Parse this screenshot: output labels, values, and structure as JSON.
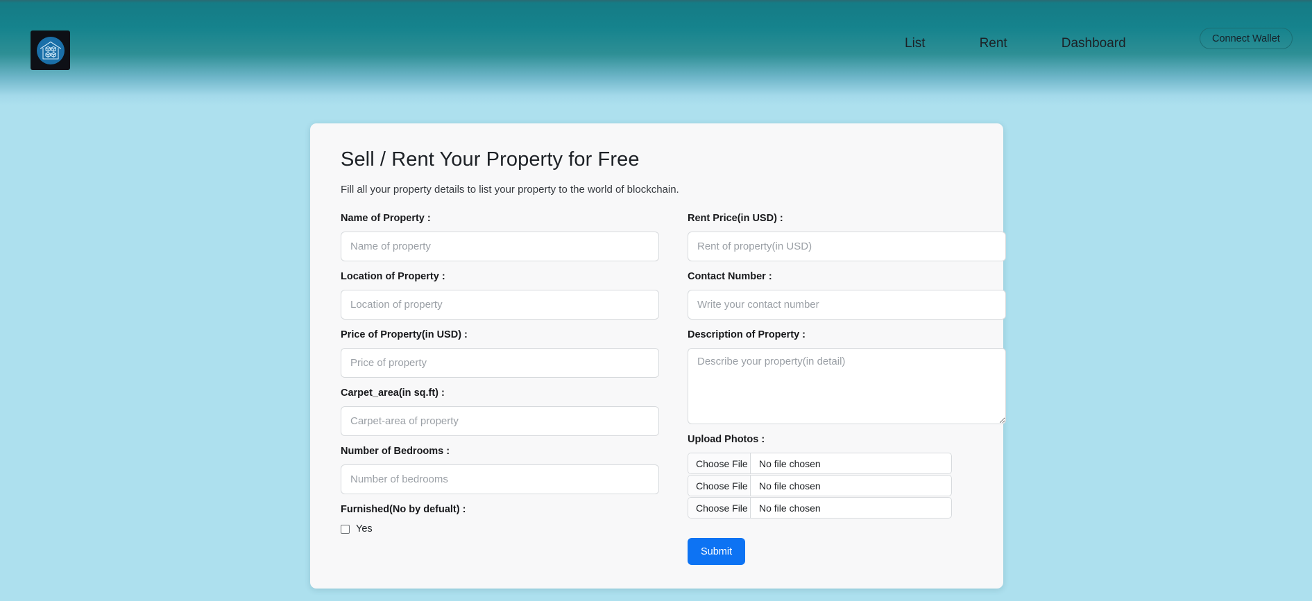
{
  "header": {
    "logo_icon": "blockchain-house-icon",
    "nav": [
      {
        "label": "List"
      },
      {
        "label": "Rent"
      },
      {
        "label": "Dashboard"
      }
    ],
    "wallet_button": "Connect Wallet"
  },
  "card": {
    "title": "Sell / Rent Your Property for Free",
    "subtitle": "Fill all your property details to list your property to the world of blockchain.",
    "left_column": {
      "name": {
        "label": "Name of Property :",
        "placeholder": "Name of property",
        "value": ""
      },
      "location": {
        "label": "Location of Property :",
        "placeholder": "Location of property",
        "value": ""
      },
      "price": {
        "label": "Price of Property(in USD) :",
        "placeholder": "Price of property",
        "value": ""
      },
      "carpet_area": {
        "label": "Carpet_area(in sq.ft) :",
        "placeholder": "Carpet-area of property",
        "value": ""
      },
      "bedrooms": {
        "label": "Number of Bedrooms :",
        "placeholder": "Number of bedrooms",
        "value": ""
      },
      "furnished": {
        "label": "Furnished(No by defualt) :",
        "checkbox_label": "Yes",
        "checked": false
      }
    },
    "right_column": {
      "rent_price": {
        "label": "Rent Price(in USD) :",
        "placeholder": "Rent of property(in USD)",
        "value": ""
      },
      "contact": {
        "label": "Contact Number :",
        "placeholder": "Write your contact number",
        "value": ""
      },
      "description": {
        "label": "Description of Property :",
        "placeholder": "Describe your property(in detail)",
        "value": ""
      },
      "upload": {
        "label": "Upload Photos :",
        "rows": [
          {
            "button": "Choose File",
            "status": "No file chosen"
          },
          {
            "button": "Choose File",
            "status": "No file chosen"
          },
          {
            "button": "Choose File",
            "status": "No file chosen"
          }
        ]
      },
      "submit_button": "Submit"
    }
  },
  "colors": {
    "header_gradient_top": "#157b85",
    "header_gradient_bottom": "#ade0ee",
    "page_background": "#ade0ee",
    "card_background": "#f8f8f9",
    "submit_blue": "#0d73f3",
    "wallet_border": "#1b6d73",
    "logo_circle": "#1a6fa8",
    "logo_square": "#0e1016"
  }
}
